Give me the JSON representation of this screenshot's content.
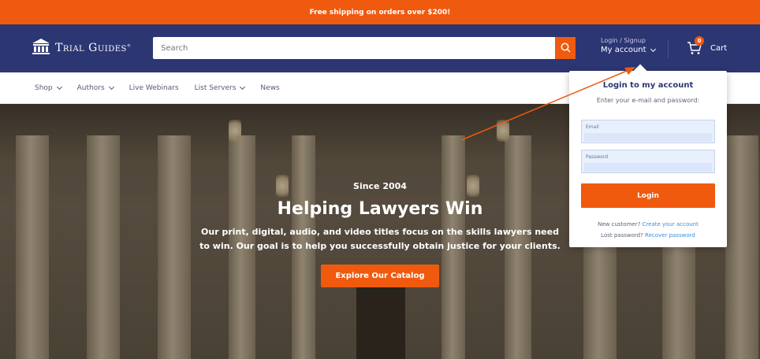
{
  "promo": {
    "text": "Free shipping on orders over $200!"
  },
  "header": {
    "logo_text": "Trial Guides",
    "logo_mark": "®",
    "search_placeholder": "Search",
    "account_small": "Login / Signup",
    "account_main": "My account",
    "cart_count": "0",
    "cart_label": "Cart"
  },
  "nav": {
    "items": [
      {
        "label": "Shop",
        "dropdown": true
      },
      {
        "label": "Authors",
        "dropdown": true
      },
      {
        "label": "Live Webinars",
        "dropdown": false
      },
      {
        "label": "List Servers",
        "dropdown": true
      },
      {
        "label": "News",
        "dropdown": false
      }
    ]
  },
  "hero": {
    "since": "Since 2004",
    "headline": "Helping Lawyers Win",
    "tagline": "Our print, digital, audio, and video titles focus on the skills lawyers need to win. Our goal is to help you successfully obtain justice for your clients.",
    "cta": "Explore Our Catalog"
  },
  "login": {
    "title": "Login to my account",
    "subtitle": "Enter your e-mail and password:",
    "email_label": "Email",
    "password_label": "Password",
    "button": "Login",
    "new_customer": "New customer?",
    "create_account": "Create your account",
    "lost_password": "Lost password?",
    "recover_password": "Recover password"
  },
  "colors": {
    "accent": "#f05a0f",
    "brand": "#2c3673",
    "link": "#3a8fd9"
  }
}
